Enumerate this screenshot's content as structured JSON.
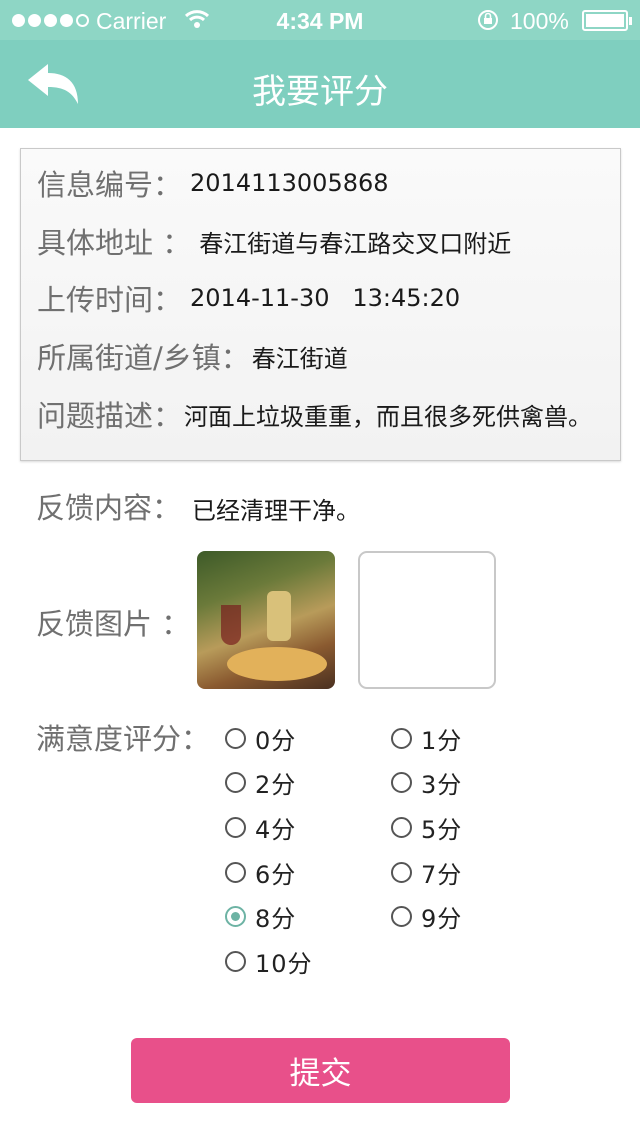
{
  "status_bar": {
    "carrier": "Carrier",
    "time": "4:34 PM",
    "battery": "100%"
  },
  "nav": {
    "title": "我要评分"
  },
  "info": {
    "rows": [
      {
        "label": "信息编号：",
        "value": "2014113005868"
      },
      {
        "label": "具体地址 ：",
        "value": "春江街道与春江路交叉口附近"
      },
      {
        "label": "上传时间：",
        "value": "2014-11-30   13:45:20"
      },
      {
        "label": "所属街道/乡镇：",
        "value": "春江街道"
      },
      {
        "label": "问题描述：",
        "value": "河面上垃圾重重，而且很多死供禽兽。"
      }
    ]
  },
  "feedback": {
    "content_label": "反馈内容：",
    "content_value": "已经清理干净。",
    "images_label": "反馈图片 ："
  },
  "rating": {
    "label": "满意度评分：",
    "options": [
      "0分",
      "1分",
      "2分",
      "3分",
      "4分",
      "5分",
      "6分",
      "7分",
      "8分",
      "9分",
      "10分"
    ],
    "selected": "8分"
  },
  "submit_label": "提交",
  "colors": {
    "status_bar": "#8ed6c5",
    "nav_bar": "#7fcfbf",
    "submit": "#e8508a",
    "radio_checked": "#6db3a4"
  }
}
